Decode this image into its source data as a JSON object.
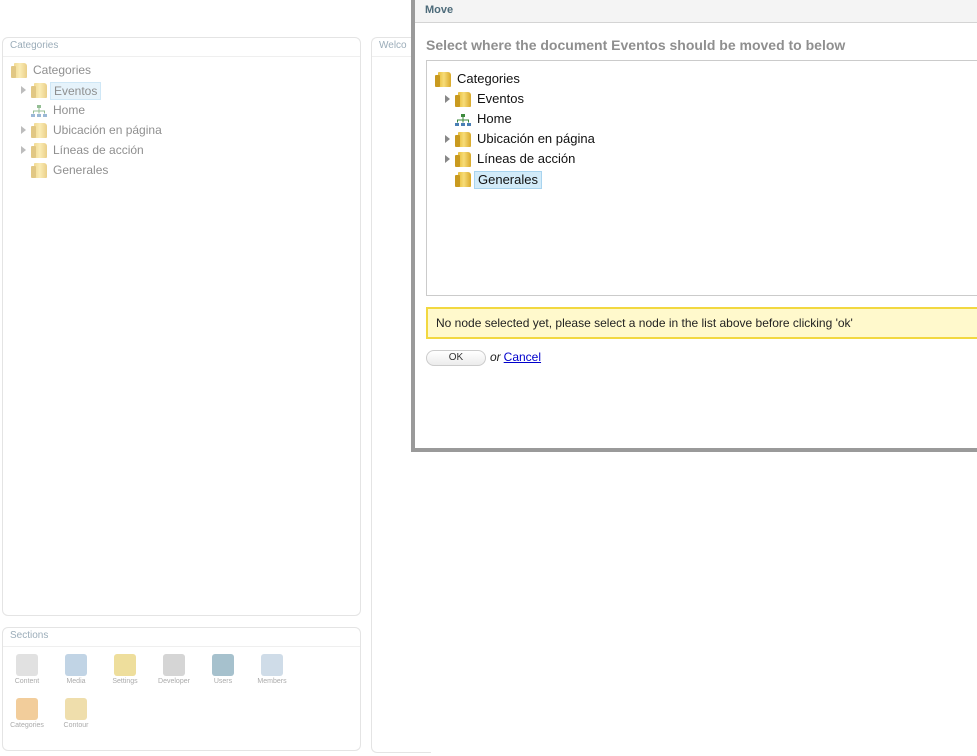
{
  "background": {
    "categories_panel_title": "Categories",
    "welcome_panel_title": "Welco",
    "sections_panel_title": "Sections",
    "tree": [
      {
        "label": "Categories",
        "icon": "folder-icon",
        "expandable": false,
        "selected": false,
        "indent": 0
      },
      {
        "label": "Eventos",
        "icon": "folder-icon",
        "expandable": true,
        "selected": true,
        "indent": 1
      },
      {
        "label": "Home",
        "icon": "sitemap-icon",
        "expandable": false,
        "selected": false,
        "indent": 1
      },
      {
        "label": "Ubicación en página",
        "icon": "folder-icon",
        "expandable": true,
        "selected": false,
        "indent": 1
      },
      {
        "label": "Líneas de acción",
        "icon": "folder-icon",
        "expandable": true,
        "selected": false,
        "indent": 1
      },
      {
        "label": "Generales",
        "icon": "folder-icon",
        "expandable": false,
        "selected": false,
        "indent": 1
      }
    ],
    "sections": [
      {
        "label": "Content",
        "icon": "content-icon",
        "color": "#c9c9c9"
      },
      {
        "label": "Media",
        "icon": "media-icon",
        "color": "#8fb1d0"
      },
      {
        "label": "Settings",
        "icon": "settings-icon",
        "color": "#e1c44c"
      },
      {
        "label": "Developer",
        "icon": "developer-icon",
        "color": "#b3b3b3"
      },
      {
        "label": "Users",
        "icon": "users-icon",
        "color": "#5f8fa6"
      },
      {
        "label": "Members",
        "icon": "members-icon",
        "color": "#a8c0d6"
      },
      {
        "label": "Categories",
        "icon": "categories-icon",
        "color": "#e8a64a"
      },
      {
        "label": "Contour",
        "icon": "contour-icon",
        "color": "#e3c46a"
      }
    ]
  },
  "modal": {
    "title": "Move",
    "instruction": "Select where the document Eventos should be moved to below",
    "tree": [
      {
        "label": "Categories",
        "icon": "folder-icon",
        "expandable": false,
        "selected": false,
        "indent": 0
      },
      {
        "label": "Eventos",
        "icon": "folder-icon",
        "expandable": true,
        "selected": false,
        "indent": 1
      },
      {
        "label": "Home",
        "icon": "sitemap-icon",
        "expandable": false,
        "selected": false,
        "indent": 1
      },
      {
        "label": "Ubicación en página",
        "icon": "folder-icon",
        "expandable": true,
        "selected": false,
        "indent": 1
      },
      {
        "label": "Líneas de acción",
        "icon": "folder-icon",
        "expandable": true,
        "selected": false,
        "indent": 1
      },
      {
        "label": "Generales",
        "icon": "folder-icon",
        "expandable": false,
        "selected": true,
        "indent": 1
      }
    ],
    "warning": "No node selected yet, please select a node in the list above before clicking 'ok'",
    "ok_label": "OK",
    "or_text": "or",
    "cancel_label": "Cancel"
  },
  "colors": {
    "selection_bg": "#d2ebf9",
    "warning_bg": "#fff9cc",
    "warning_border": "#f2d840",
    "link": "#0000cc"
  }
}
